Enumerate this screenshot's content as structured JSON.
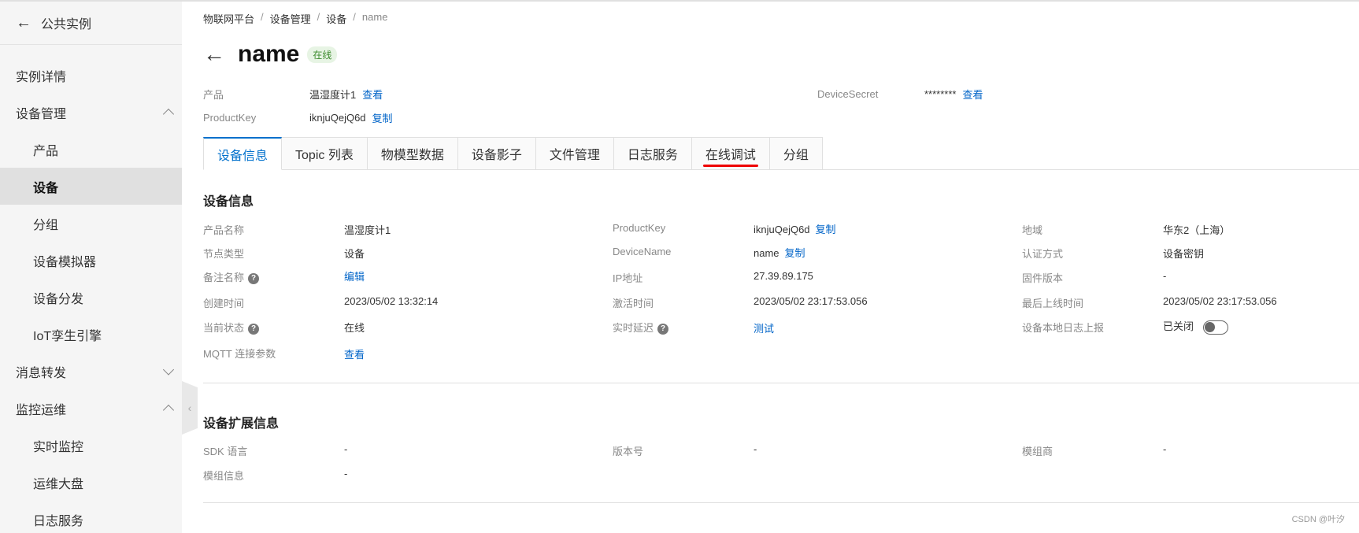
{
  "sidebar": {
    "back_label": "公共实例",
    "items": [
      {
        "label": "实例详情"
      },
      {
        "label": "设备管理"
      },
      {
        "label": "产品"
      },
      {
        "label": "设备"
      },
      {
        "label": "分组"
      },
      {
        "label": "设备模拟器"
      },
      {
        "label": "设备分发"
      },
      {
        "label": "IoT孪生引擎"
      },
      {
        "label": "消息转发"
      },
      {
        "label": "监控运维"
      },
      {
        "label": "实时监控"
      },
      {
        "label": "运维大盘"
      },
      {
        "label": "日志服务"
      }
    ]
  },
  "breadcrumb": [
    "物联网平台",
    "设备管理",
    "设备",
    "name"
  ],
  "header": {
    "title": "name",
    "status": "在线",
    "product_label": "产品",
    "product_value": "温湿度计1",
    "product_link": "查看",
    "productkey_label": "ProductKey",
    "productkey_value": "iknjuQejQ6d",
    "productkey_link": "复制",
    "secret_label": "DeviceSecret",
    "secret_value": "********",
    "secret_link": "查看"
  },
  "tabs": [
    {
      "label": "设备信息"
    },
    {
      "label": "Topic 列表"
    },
    {
      "label": "物模型数据"
    },
    {
      "label": "设备影子"
    },
    {
      "label": "文件管理"
    },
    {
      "label": "日志服务"
    },
    {
      "label": "在线调试"
    },
    {
      "label": "分组"
    }
  ],
  "device_info": {
    "title": "设备信息",
    "product_name_label": "产品名称",
    "product_name": "温湿度计1",
    "node_type_label": "节点类型",
    "node_type": "设备",
    "remark_label": "备注名称",
    "remark_link": "编辑",
    "created_label": "创建时间",
    "created": "2023/05/02 13:32:14",
    "state_label": "当前状态",
    "state": "在线",
    "mqtt_label": "MQTT 连接参数",
    "mqtt_link": "查看",
    "pk_label": "ProductKey",
    "pk": "iknjuQejQ6d",
    "pk_link": "复制",
    "dn_label": "DeviceName",
    "dn": "name",
    "dn_link": "复制",
    "ip_label": "IP地址",
    "ip": "27.39.89.175",
    "activated_label": "激活时间",
    "activated": "2023/05/02 23:17:53.056",
    "delay_label": "实时延迟",
    "delay_link": "测试",
    "region_label": "地域",
    "region": "华东2（上海）",
    "auth_label": "认证方式",
    "auth": "设备密钥",
    "fw_label": "固件版本",
    "fw": "-",
    "last_online_label": "最后上线时间",
    "last_online": "2023/05/02 23:17:53.056",
    "local_log_label": "设备本地日志上报",
    "local_log": "已关闭"
  },
  "ext_info": {
    "title": "设备扩展信息",
    "sdk_label": "SDK 语言",
    "sdk": "-",
    "version_label": "版本号",
    "version": "-",
    "vendor_label": "模组商",
    "vendor": "-",
    "module_label": "模组信息",
    "module": "-"
  },
  "watermark": "CSDN @叶汐"
}
